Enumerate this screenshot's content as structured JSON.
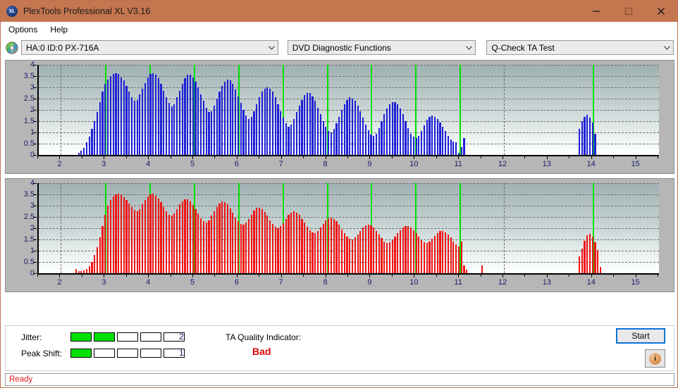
{
  "window": {
    "title": "PlexTools Professional XL V3.16",
    "icon": "xl-app-icon",
    "minimize_label": "minimize-icon",
    "maximize_label": "maximize-icon",
    "close_label": "close-icon",
    "titlebar_color": "#c4764f"
  },
  "menu": {
    "items": [
      {
        "label": "Options"
      },
      {
        "label": "Help"
      }
    ]
  },
  "selectors": {
    "drive_icon": "disc-icon",
    "drive": {
      "value": "HA:0 ID:0  PX-716A"
    },
    "function": {
      "value": "DVD Diagnostic Functions"
    },
    "test": {
      "value": "Q-Check TA Test"
    }
  },
  "chart_data": [
    {
      "type": "bar",
      "title": "",
      "name": "jitter-chart",
      "series_color": "#1e20d8",
      "xlabel": "",
      "ylabel": "",
      "xlim": [
        1.5,
        15.5
      ],
      "ylim": [
        0,
        4
      ],
      "yticks": [
        0,
        0.5,
        1,
        1.5,
        2,
        2.5,
        3,
        3.5,
        4
      ],
      "ytick_labels": [
        "0",
        "0.5",
        "1",
        "1.5",
        "2",
        "2.5",
        "3",
        "3.5",
        "4"
      ],
      "xticks": [
        2,
        3,
        4,
        5,
        6,
        7,
        8,
        9,
        10,
        11,
        12,
        13,
        14,
        15
      ],
      "xtick_labels": [
        "2",
        "3",
        "4",
        "5",
        "6",
        "7",
        "8",
        "9",
        "10",
        "11",
        "12",
        "13",
        "14",
        "15"
      ],
      "grid": true,
      "markers_x": [
        3,
        4,
        5,
        6,
        7,
        8,
        9,
        10,
        11,
        14
      ],
      "marker_color": "#00e000",
      "x": [
        2.4,
        2.46,
        2.52,
        2.58,
        2.64,
        2.7,
        2.76,
        2.82,
        2.88,
        2.94,
        3.0,
        3.06,
        3.12,
        3.18,
        3.24,
        3.3,
        3.36,
        3.42,
        3.48,
        3.54,
        3.6,
        3.66,
        3.72,
        3.78,
        3.84,
        3.9,
        3.96,
        4.02,
        4.08,
        4.14,
        4.2,
        4.26,
        4.32,
        4.38,
        4.44,
        4.5,
        4.56,
        4.62,
        4.68,
        4.74,
        4.8,
        4.86,
        4.92,
        4.98,
        5.04,
        5.1,
        5.16,
        5.22,
        5.28,
        5.34,
        5.4,
        5.46,
        5.52,
        5.58,
        5.64,
        5.7,
        5.76,
        5.82,
        5.88,
        5.94,
        6.0,
        6.06,
        6.12,
        6.18,
        6.24,
        6.3,
        6.36,
        6.42,
        6.48,
        6.54,
        6.6,
        6.66,
        6.72,
        6.78,
        6.84,
        6.9,
        6.96,
        7.02,
        7.08,
        7.14,
        7.2,
        7.26,
        7.32,
        7.38,
        7.44,
        7.5,
        7.56,
        7.62,
        7.68,
        7.74,
        7.8,
        7.86,
        7.92,
        7.98,
        8.04,
        8.1,
        8.16,
        8.22,
        8.28,
        8.34,
        8.4,
        8.46,
        8.52,
        8.58,
        8.64,
        8.7,
        8.76,
        8.82,
        8.88,
        8.94,
        9.0,
        9.06,
        9.12,
        9.18,
        9.24,
        9.3,
        9.36,
        9.42,
        9.48,
        9.54,
        9.6,
        9.66,
        9.72,
        9.78,
        9.84,
        9.9,
        9.96,
        10.02,
        10.08,
        10.14,
        10.2,
        10.26,
        10.32,
        10.38,
        10.44,
        10.5,
        10.56,
        10.62,
        10.68,
        10.74,
        10.8,
        10.86,
        10.92,
        10.98,
        11.04,
        11.1,
        13.7,
        13.76,
        13.82,
        13.88,
        13.94,
        14.0,
        14.06,
        14.12,
        14.18,
        14.24
      ],
      "values": [
        0.1,
        0.18,
        0.3,
        0.55,
        0.82,
        1.15,
        1.5,
        1.9,
        2.35,
        2.8,
        3.15,
        3.35,
        3.5,
        3.6,
        3.62,
        3.58,
        3.45,
        3.3,
        3.05,
        2.8,
        2.55,
        2.4,
        2.45,
        2.7,
        2.95,
        3.2,
        3.45,
        3.6,
        3.62,
        3.55,
        3.4,
        3.15,
        2.85,
        2.55,
        2.3,
        2.15,
        2.25,
        2.55,
        2.85,
        3.15,
        3.4,
        3.55,
        3.55,
        3.45,
        3.25,
        3.0,
        2.7,
        2.4,
        2.1,
        1.9,
        1.95,
        2.2,
        2.5,
        2.8,
        3.05,
        3.25,
        3.35,
        3.3,
        3.15,
        2.9,
        2.6,
        2.3,
        2.0,
        1.75,
        1.6,
        1.7,
        1.95,
        2.25,
        2.55,
        2.8,
        2.95,
        3.0,
        2.95,
        2.8,
        2.55,
        2.25,
        1.95,
        1.65,
        1.4,
        1.25,
        1.35,
        1.6,
        1.9,
        2.2,
        2.45,
        2.65,
        2.75,
        2.75,
        2.6,
        2.4,
        2.1,
        1.8,
        1.5,
        1.25,
        1.05,
        1.0,
        1.15,
        1.4,
        1.7,
        2.0,
        2.25,
        2.45,
        2.55,
        2.5,
        2.4,
        2.2,
        1.95,
        1.65,
        1.35,
        1.1,
        0.9,
        0.85,
        0.95,
        1.2,
        1.5,
        1.8,
        2.05,
        2.25,
        2.35,
        2.35,
        2.25,
        2.05,
        1.8,
        1.5,
        1.2,
        0.95,
        0.8,
        0.75,
        0.85,
        1.05,
        1.3,
        1.55,
        1.7,
        1.75,
        1.7,
        1.6,
        1.45,
        1.25,
        1.05,
        0.85,
        0.7,
        0.6,
        0.55,
        0.1,
        0.35,
        0.75,
        1.15,
        1.5,
        1.7,
        1.78,
        1.65,
        1.45,
        0.95
      ]
    },
    {
      "type": "bar",
      "title": "",
      "name": "peak-shift-chart",
      "series_color": "#f21414",
      "xlabel": "",
      "ylabel": "",
      "xlim": [
        1.5,
        15.5
      ],
      "ylim": [
        0,
        4
      ],
      "yticks": [
        0,
        0.5,
        1,
        1.5,
        2,
        2.5,
        3,
        3.5,
        4
      ],
      "ytick_labels": [
        "0",
        "0.5",
        "1",
        "1.5",
        "2",
        "2.5",
        "3",
        "3.5",
        "4"
      ],
      "xticks": [
        2,
        3,
        4,
        5,
        6,
        7,
        8,
        9,
        10,
        11,
        12,
        13,
        14,
        15
      ],
      "xtick_labels": [
        "2",
        "3",
        "4",
        "5",
        "6",
        "7",
        "8",
        "9",
        "10",
        "11",
        "12",
        "13",
        "14",
        "15"
      ],
      "grid": true,
      "markers_x": [
        3,
        4,
        5,
        6,
        7,
        8,
        9,
        10,
        11,
        14
      ],
      "marker_color": "#00e000",
      "x": [
        2.34,
        2.4,
        2.46,
        2.52,
        2.58,
        2.64,
        2.7,
        2.76,
        2.82,
        2.88,
        2.94,
        3.0,
        3.06,
        3.12,
        3.18,
        3.24,
        3.3,
        3.36,
        3.42,
        3.48,
        3.54,
        3.6,
        3.66,
        3.72,
        3.78,
        3.84,
        3.9,
        3.96,
        4.02,
        4.08,
        4.14,
        4.2,
        4.26,
        4.32,
        4.38,
        4.44,
        4.5,
        4.56,
        4.62,
        4.68,
        4.74,
        4.8,
        4.86,
        4.92,
        4.98,
        5.04,
        5.1,
        5.16,
        5.22,
        5.28,
        5.34,
        5.4,
        5.46,
        5.52,
        5.58,
        5.64,
        5.7,
        5.76,
        5.82,
        5.88,
        5.94,
        6.0,
        6.06,
        6.12,
        6.18,
        6.24,
        6.3,
        6.36,
        6.42,
        6.48,
        6.54,
        6.6,
        6.66,
        6.72,
        6.78,
        6.84,
        6.9,
        6.96,
        7.02,
        7.08,
        7.14,
        7.2,
        7.26,
        7.32,
        7.38,
        7.44,
        7.5,
        7.56,
        7.62,
        7.68,
        7.74,
        7.8,
        7.86,
        7.92,
        7.98,
        8.04,
        8.1,
        8.16,
        8.22,
        8.28,
        8.34,
        8.4,
        8.46,
        8.52,
        8.58,
        8.64,
        8.7,
        8.76,
        8.82,
        8.88,
        8.94,
        9.0,
        9.06,
        9.12,
        9.18,
        9.24,
        9.3,
        9.36,
        9.42,
        9.48,
        9.54,
        9.6,
        9.66,
        9.72,
        9.78,
        9.84,
        9.9,
        9.96,
        10.02,
        10.08,
        10.14,
        10.2,
        10.26,
        10.32,
        10.38,
        10.44,
        10.5,
        10.56,
        10.62,
        10.68,
        10.74,
        10.8,
        10.86,
        10.92,
        10.98,
        11.04,
        11.1,
        11.16,
        11.5,
        13.7,
        13.76,
        13.82,
        13.88,
        13.94,
        14.0,
        14.06,
        14.12,
        14.18,
        14.24,
        14.32
      ],
      "values": [
        0.18,
        0.1,
        0.08,
        0.12,
        0.18,
        0.3,
        0.5,
        0.8,
        1.15,
        1.6,
        2.1,
        2.6,
        3.0,
        3.25,
        3.4,
        3.5,
        3.52,
        3.48,
        3.38,
        3.25,
        3.1,
        2.95,
        2.8,
        2.75,
        2.85,
        3.05,
        3.25,
        3.4,
        3.5,
        3.52,
        3.45,
        3.32,
        3.15,
        2.95,
        2.75,
        2.6,
        2.55,
        2.65,
        2.85,
        3.05,
        3.2,
        3.28,
        3.28,
        3.18,
        3.02,
        2.85,
        2.65,
        2.45,
        2.3,
        2.25,
        2.35,
        2.55,
        2.75,
        2.95,
        3.1,
        3.18,
        3.15,
        3.05,
        2.88,
        2.68,
        2.48,
        2.3,
        2.18,
        2.15,
        2.25,
        2.42,
        2.6,
        2.78,
        2.9,
        2.92,
        2.85,
        2.72,
        2.55,
        2.35,
        2.18,
        2.05,
        2.0,
        2.08,
        2.22,
        2.4,
        2.58,
        2.7,
        2.75,
        2.7,
        2.58,
        2.42,
        2.25,
        2.05,
        1.9,
        1.8,
        1.78,
        1.88,
        2.02,
        2.2,
        2.35,
        2.45,
        2.48,
        2.42,
        2.3,
        2.15,
        1.95,
        1.78,
        1.62,
        1.52,
        1.5,
        1.58,
        1.72,
        1.88,
        2.02,
        2.12,
        2.15,
        2.12,
        2.02,
        1.88,
        1.72,
        1.55,
        1.42,
        1.35,
        1.38,
        1.48,
        1.62,
        1.78,
        1.92,
        2.02,
        2.08,
        2.08,
        2.02,
        1.92,
        1.78,
        1.62,
        1.48,
        1.38,
        1.35,
        1.4,
        1.52,
        1.65,
        1.78,
        1.86,
        1.88,
        1.82,
        1.72,
        1.58,
        1.42,
        1.28,
        1.18,
        1.42,
        0.35,
        0.15,
        0.35,
        0.75,
        1.1,
        1.45,
        1.68,
        1.75,
        1.62,
        1.38,
        1.02,
        0.28
      ]
    }
  ],
  "metrics": {
    "jitter": {
      "label": "Jitter:",
      "value": "2",
      "filled": 2,
      "total": 5
    },
    "peak_shift": {
      "label": "Peak Shift:",
      "value": "1",
      "filled": 1,
      "total": 5
    },
    "meter_on_color": "#00e000"
  },
  "quality": {
    "label": "TA Quality Indicator:",
    "value": "Bad",
    "value_color": "#e00000"
  },
  "actions": {
    "start_label": "Start",
    "info_icon": "info-icon"
  },
  "status": {
    "text": "Ready",
    "color": "#e02020"
  }
}
